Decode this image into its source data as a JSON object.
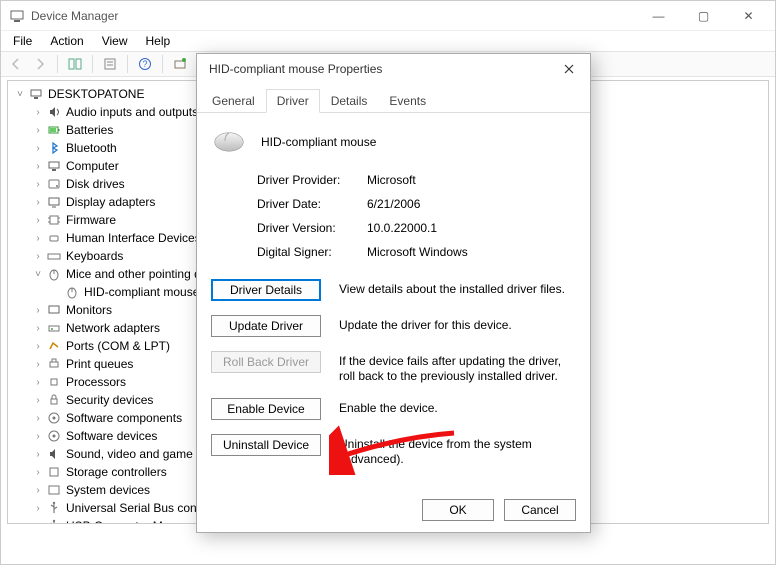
{
  "window": {
    "title": "Device Manager",
    "controls": {
      "min": "—",
      "max": "▢",
      "close": "✕"
    }
  },
  "menu": [
    "File",
    "Action",
    "View",
    "Help"
  ],
  "tree": {
    "root": "DESKTOPATONE",
    "items": [
      "Audio inputs and outputs",
      "Batteries",
      "Bluetooth",
      "Computer",
      "Disk drives",
      "Display adapters",
      "Firmware",
      "Human Interface Devices",
      "Keyboards"
    ],
    "mice_label": "Mice and other pointing devices",
    "mice_child": "HID-compliant mouse",
    "items_after": [
      "Monitors",
      "Network adapters",
      "Ports (COM & LPT)",
      "Print queues",
      "Processors",
      "Security devices",
      "Software components",
      "Software devices",
      "Sound, video and game controllers",
      "Storage controllers",
      "System devices",
      "Universal Serial Bus controllers",
      "USB Connector Managers"
    ]
  },
  "dialog": {
    "title": "HID-compliant mouse Properties",
    "tabs": [
      "General",
      "Driver",
      "Details",
      "Events"
    ],
    "active_tab": 1,
    "device_name": "HID-compliant mouse",
    "info": {
      "provider_label": "Driver Provider:",
      "provider": "Microsoft",
      "date_label": "Driver Date:",
      "date": "6/21/2006",
      "version_label": "Driver Version:",
      "version": "10.0.22000.1",
      "signer_label": "Digital Signer:",
      "signer": "Microsoft Windows"
    },
    "actions": {
      "details_btn": "Driver Details",
      "details_desc": "View details about the installed driver files.",
      "update_btn": "Update Driver",
      "update_desc": "Update the driver for this device.",
      "rollback_btn": "Roll Back Driver",
      "rollback_desc": "If the device fails after updating the driver, roll back to the previously installed driver.",
      "enable_btn": "Enable Device",
      "enable_desc": "Enable the device.",
      "uninstall_btn": "Uninstall Device",
      "uninstall_desc": "Uninstall the device from the system (Advanced)."
    },
    "footer": {
      "ok": "OK",
      "cancel": "Cancel"
    }
  }
}
